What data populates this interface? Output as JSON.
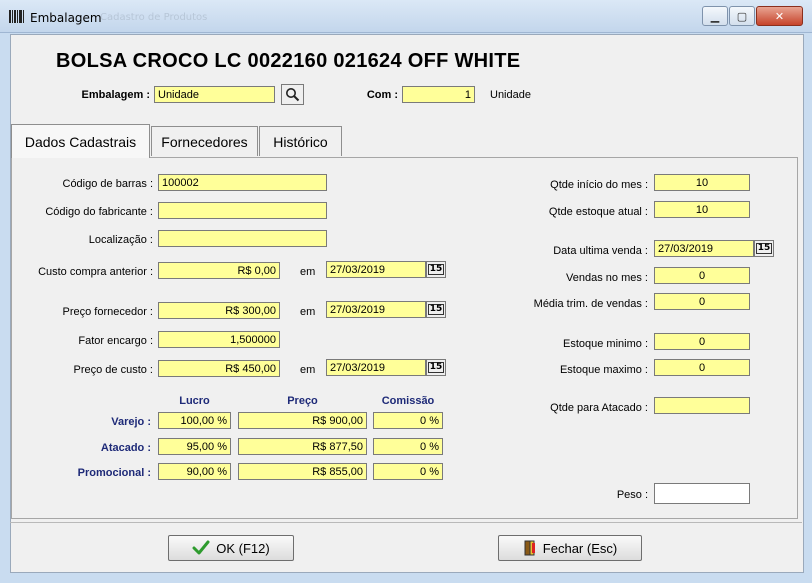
{
  "window": {
    "title": "Embalagem",
    "ghost_title": "Cadastro de Produtos"
  },
  "product": {
    "name": "BOLSA CROCO LC 0022160 021624 OFF WHITE"
  },
  "embalagem": {
    "label": "Embalagem :",
    "value": "Unidade"
  },
  "com": {
    "label": "Com :",
    "value": "1",
    "unit": "Unidade"
  },
  "tabs": [
    {
      "label": "Dados Cadastrais",
      "active": true
    },
    {
      "label": "Fornecedores",
      "active": false
    },
    {
      "label": "Histórico",
      "active": false
    }
  ],
  "left": {
    "codigo_barras": {
      "label": "Código de barras :",
      "value": "100002"
    },
    "codigo_fabricante": {
      "label": "Código do fabricante :",
      "value": ""
    },
    "localizacao": {
      "label": "Localização :",
      "value": ""
    },
    "custo_compra": {
      "label": "Custo compra anterior :",
      "value": "R$ 0,00",
      "em": "em",
      "date": "27/03/2019"
    },
    "preco_fornecedor": {
      "label": "Preço fornecedor :",
      "value": "R$ 300,00",
      "em": "em",
      "date": "27/03/2019"
    },
    "fator_encargo": {
      "label": "Fator encargo :",
      "value": "1,500000"
    },
    "preco_custo": {
      "label": "Preço de custo :",
      "value": "R$ 450,00",
      "em": "em",
      "date": "27/03/2019"
    }
  },
  "pricing": {
    "headers": {
      "lucro": "Lucro",
      "preco": "Preço",
      "comissao": "Comissão"
    },
    "rows": [
      {
        "label": "Varejo :",
        "lucro": "100,00 %",
        "preco": "R$ 900,00",
        "comissao": "0 %"
      },
      {
        "label": "Atacado :",
        "lucro": "95,00 %",
        "preco": "R$ 877,50",
        "comissao": "0 %"
      },
      {
        "label": "Promocional :",
        "lucro": "90,00 %",
        "preco": "R$ 855,00",
        "comissao": "0 %"
      }
    ]
  },
  "right": {
    "qtde_inicio_mes": {
      "label": "Qtde início do mes :",
      "value": "10"
    },
    "qtde_estoque_atual": {
      "label": "Qtde estoque atual :",
      "value": "10"
    },
    "data_ultima_venda": {
      "label": "Data ultima venda :",
      "value": "27/03/2019"
    },
    "vendas_mes": {
      "label": "Vendas no mes :",
      "value": "0"
    },
    "media_trim": {
      "label": "Média trim. de vendas :",
      "value": "0"
    },
    "estoque_minimo": {
      "label": "Estoque minimo :",
      "value": "0"
    },
    "estoque_maximo": {
      "label": "Estoque maximo :",
      "value": "0"
    },
    "qtde_atacado": {
      "label": "Qtde para Atacado :",
      "value": ""
    },
    "peso": {
      "label": "Peso :",
      "value": ""
    }
  },
  "buttons": {
    "ok": "OK (F12)",
    "fechar": "Fechar (Esc)"
  },
  "calendar_icon_text": "15",
  "colors": {
    "field": "#ffff99",
    "label_blue": "#1e2a78",
    "ok_check": "#2e9b2e"
  }
}
